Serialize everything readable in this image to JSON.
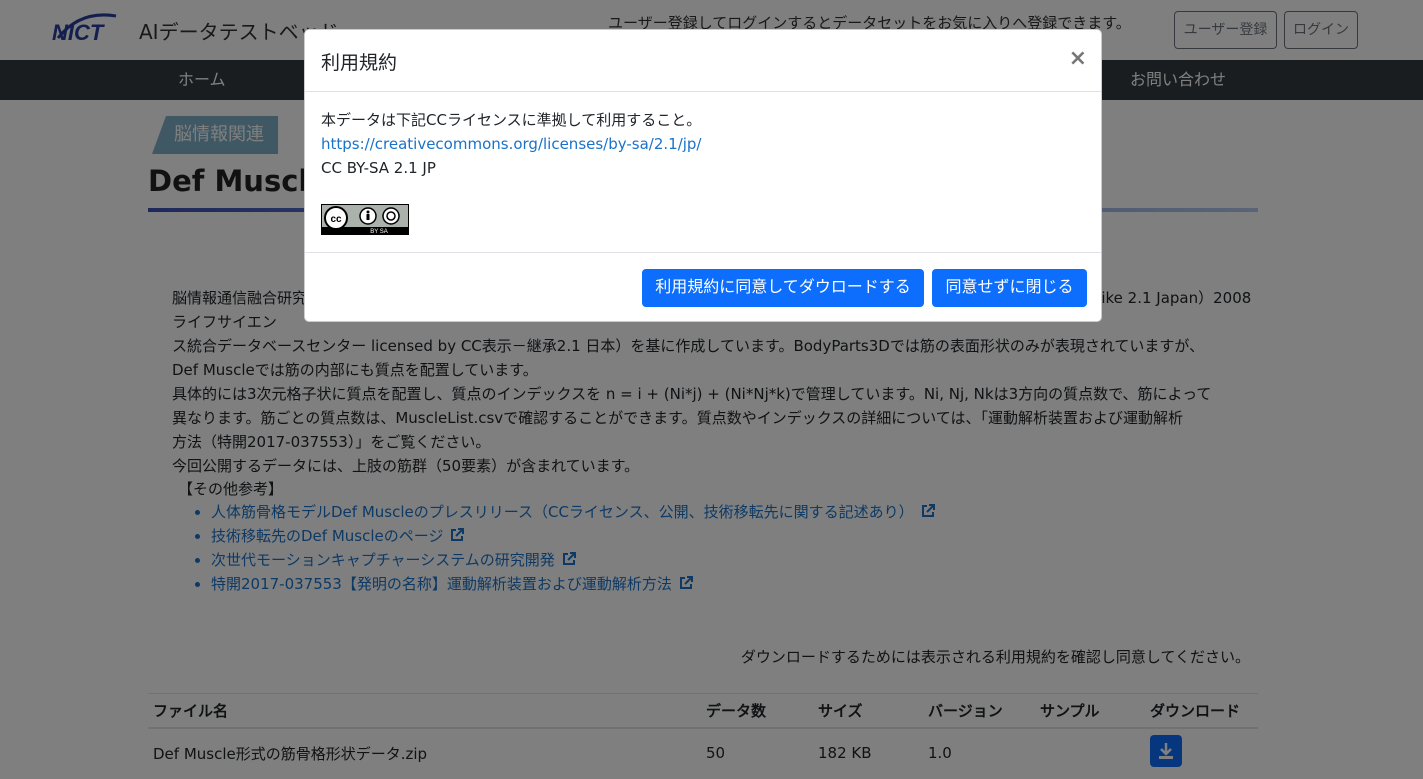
{
  "header": {
    "logo_text": "NICT",
    "site_title": "AIデータテストベッド",
    "message": "ユーザー登録してログインするとデータセットをお気に入りへ登録できます。",
    "register_label": "ユーザー登録",
    "login_label": "ログイン"
  },
  "nav": {
    "home": "ホーム",
    "contact": "お問い合わせ"
  },
  "content": {
    "category": "脳情報関連",
    "title": "Def Muscle",
    "desc_lines": [
      "脳情報通信融合研究センター……BodyParts3D（© The Database Center for Life Science licensed under CC Attribution-Share Alike 2.1 Japan）2008 ライフサイエン",
      "ス統合データベースセンター licensed by CC表示－継承2.1 日本）を基に作成しています。BodyParts3Dでは筋の表面形状のみが表現されていますが、",
      "Def Muscleでは筋の内部にも質点を配置しています。",
      "具体的には3次元格子状に質点を配置し、質点のインデックスを n = i + (Ni*j) + (Ni*Nj*k)で管理しています。Ni, Nj, Nkは3方向の質点数で、筋によって",
      "異なります。筋ごとの質点数は、MuscleList.csvで確認することができます。質点数やインデックスの詳細については、「運動解析装置および運動解析",
      "方法（特開2017-037553）」をご覧ください。",
      "今回公開するデータには、上肢の筋群（50要素）が含まれています。"
    ],
    "refs_heading": "【その他参考】",
    "refs": [
      "人体筋骨格モデルDef Muscleのプレスリリース（CCライセンス、公開、技術移転先に関する記述あり）",
      "技術移転先のDef Muscleのページ",
      "次世代モーションキャプチャーシステムの研究開発",
      "特開2017-037553【発明の名称】運動解析装置および運動解析方法"
    ],
    "download_note": "ダウンロードするためには表示される利用規約を確認し同意してください。"
  },
  "table": {
    "headers": [
      "ファイル名",
      "データ数",
      "サイズ",
      "バージョン",
      "サンプル",
      "ダウンロード"
    ],
    "rows": [
      {
        "filename": "Def Muscle形式の筋骨格形状データ.zip",
        "count": "50",
        "size": "182 KB",
        "version": "1.0",
        "sample": ""
      }
    ]
  },
  "modal": {
    "title": "利用規約",
    "close_symbol": "×",
    "body_line1": "本データは下記CCライセンスに準拠して利用すること。",
    "license_url": "https://creativecommons.org/licenses/by-sa/2.1/jp/",
    "license_name": "CC BY-SA 2.1 JP",
    "badge_text": "BY SA",
    "agree_label": "利用規約に同意してダウロードする",
    "close_label": "同意せずに閉じる"
  },
  "colors": {
    "primary": "#0d6efd",
    "navbar": "#343a40",
    "link": "#1a73c9",
    "category": "#7fb0c9"
  }
}
